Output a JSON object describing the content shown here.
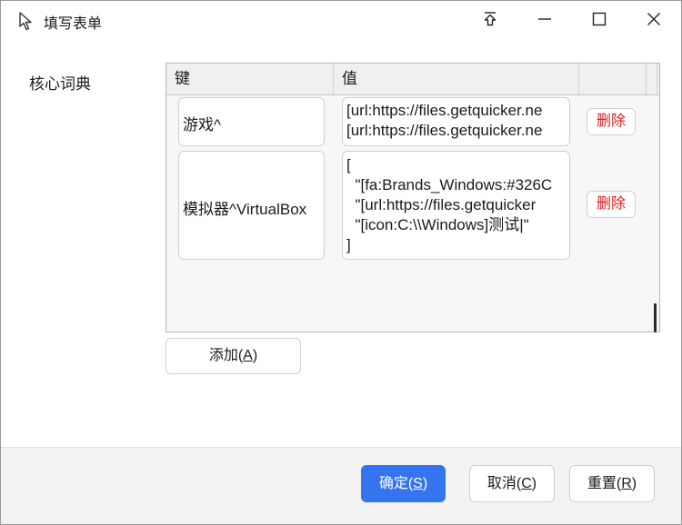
{
  "window": {
    "title": "填写表单"
  },
  "form": {
    "dict_label": "核心词典"
  },
  "grid": {
    "columns": [
      "键",
      "值",
      ""
    ],
    "rows": [
      {
        "key": "游戏^",
        "value_lines": [
          "[url:https://files.getquicker.ne",
          "[url:https://files.getquicker.ne"
        ],
        "delete_label": "删除"
      },
      {
        "key": "模拟器^VirtualBox",
        "value_lines": [
          "[",
          "  \"[fa:Brands_Windows:#326C",
          "  \"[url:https://files.getquicker",
          "  \"[icon:C:\\\\Windows]测试|\"",
          "]"
        ],
        "delete_label": "删除"
      }
    ]
  },
  "buttons": {
    "add": {
      "text": "添加(",
      "mnemonic": "A",
      "suffix": ")"
    },
    "ok": {
      "text": "确定(",
      "mnemonic": "S",
      "suffix": ")"
    },
    "cancel": {
      "text": "取消(",
      "mnemonic": "C",
      "suffix": ")"
    },
    "reset": {
      "text": "重置(",
      "mnemonic": "R",
      "suffix": ")"
    }
  },
  "colors": {
    "primary": "#3574f0",
    "danger": "#d32020",
    "footer_bg": "#f3f3f3"
  },
  "icons": {
    "app": "cursor-pointer-icon",
    "pin": "pin-top-icon",
    "minimize": "minimize-icon",
    "maximize": "maximize-icon",
    "close": "close-icon"
  }
}
